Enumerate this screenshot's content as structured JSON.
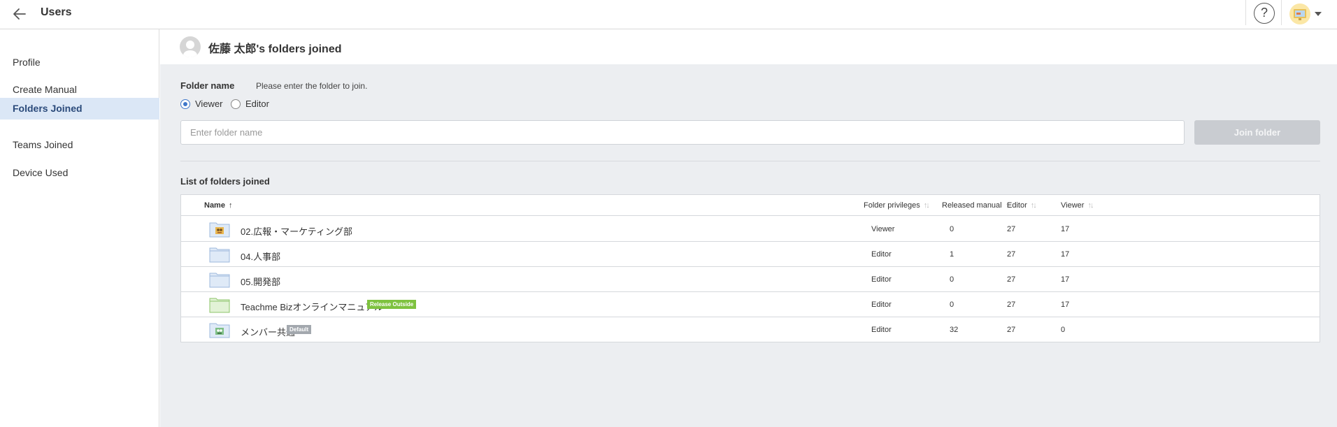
{
  "header": {
    "title": "Users",
    "help_label": "?"
  },
  "sidebar": {
    "items": [
      {
        "label": "Profile"
      },
      {
        "label": "Create Manual"
      },
      {
        "label": "Folders Joined"
      },
      {
        "label": "Teams Joined"
      },
      {
        "label": "Device Used"
      }
    ],
    "active_index": 2
  },
  "main": {
    "title": "佐藤 太郎's folders joined",
    "form": {
      "folder_name_label": "Folder name",
      "hint": "Please enter the folder to join.",
      "radio_viewer": "Viewer",
      "radio_editor": "Editor",
      "selected_role": "Viewer",
      "input_placeholder": "Enter folder name",
      "input_value": "",
      "join_button": "Join folder"
    },
    "list_title": "List of folders joined",
    "table": {
      "columns": {
        "name": "Name",
        "privileges": "Folder privileges",
        "released": "Released manual",
        "editor": "Editor",
        "viewer": "Viewer"
      },
      "rows": [
        {
          "name": "02.広報・マーケティング部",
          "badge": "",
          "icon": "folder-image-icon",
          "privilege": "Viewer",
          "released": "0",
          "editor": "27",
          "viewer": "17"
        },
        {
          "name": "04.人事部",
          "badge": "",
          "icon": "folder-icon",
          "privilege": "Editor",
          "released": "1",
          "editor": "27",
          "viewer": "17"
        },
        {
          "name": "05.開発部",
          "badge": "",
          "icon": "folder-icon",
          "privilege": "Editor",
          "released": "0",
          "editor": "27",
          "viewer": "17"
        },
        {
          "name": "Teachme Bizオンラインマニュアル",
          "badge": "Release Outside",
          "icon": "green-folder-icon",
          "privilege": "Editor",
          "released": "0",
          "editor": "27",
          "viewer": "17"
        },
        {
          "name": "メンバー共通",
          "badge": "Default",
          "icon": "folder-image-icon",
          "privilege": "Editor",
          "released": "32",
          "editor": "27",
          "viewer": "0"
        }
      ]
    }
  },
  "colors": {
    "accent": "#3f77c9",
    "sidebar_active_bg": "#dbe7f6",
    "badge_release": "#7ec23f",
    "badge_default": "#a3a8ae"
  }
}
